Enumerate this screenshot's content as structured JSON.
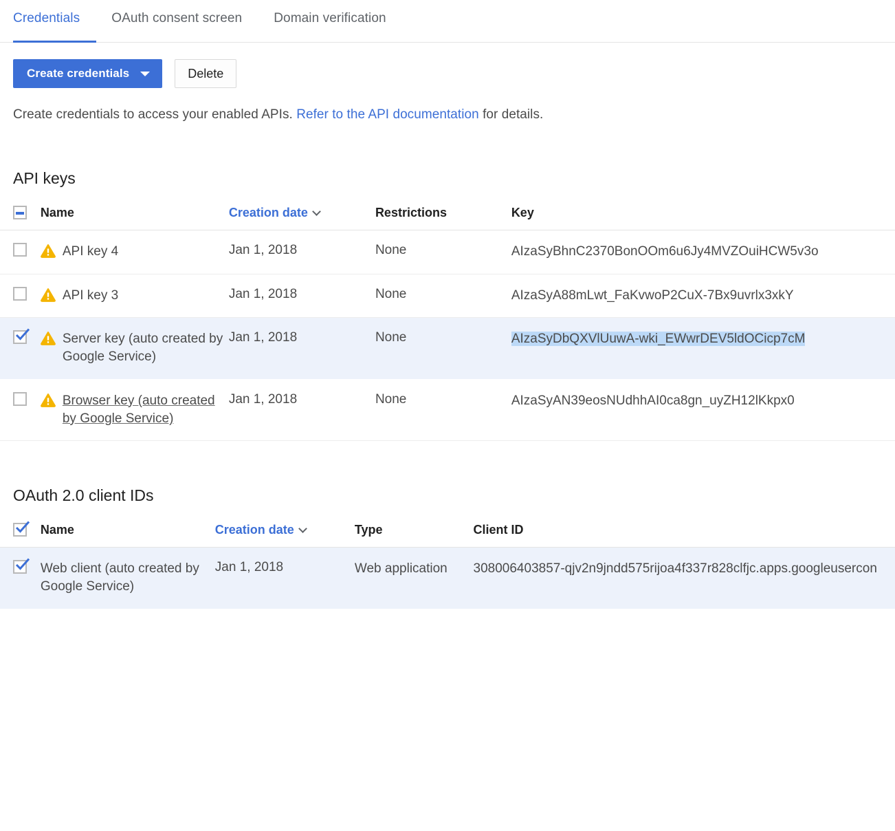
{
  "tabs": [
    {
      "label": "Credentials",
      "active": true
    },
    {
      "label": "OAuth consent screen",
      "active": false
    },
    {
      "label": "Domain verification",
      "active": false
    }
  ],
  "toolbar": {
    "create_label": "Create credentials",
    "delete_label": "Delete"
  },
  "description": {
    "before": "Create credentials to access your enabled APIs. ",
    "link": "Refer to the API documentation",
    "after": " for details."
  },
  "api_keys": {
    "title": "API keys",
    "header_checkbox_state": "indeterminate",
    "columns": [
      "Name",
      "Creation date",
      "Restrictions",
      "Key"
    ],
    "sorted_column": "Creation date",
    "rows": [
      {
        "checked": false,
        "warning": true,
        "name": "API key 4",
        "name_linked": false,
        "creation_date": "Jan 1, 2018",
        "restrictions": "None",
        "key": "AIzaSyBhnC2370BonOOm6u6Jy4MVZOuiHCW5v3o",
        "key_highlighted": false,
        "selected": false
      },
      {
        "checked": false,
        "warning": true,
        "name": "API key 3",
        "name_linked": false,
        "creation_date": "Jan 1, 2018",
        "restrictions": "None",
        "key": "AIzaSyA88mLwt_FaKvwoP2CuX-7Bx9uvrlx3xkY",
        "key_highlighted": false,
        "selected": false
      },
      {
        "checked": true,
        "warning": true,
        "name": "Server key (auto created by Google Service)",
        "name_linked": false,
        "creation_date": "Jan 1, 2018",
        "restrictions": "None",
        "key": "AIzaSyDbQXVlUuwA-wki_EWwrDEV5ldOCicp7cM",
        "key_highlighted": true,
        "selected": true
      },
      {
        "checked": false,
        "warning": true,
        "name": "Browser key (auto created by Google Service)",
        "name_linked": true,
        "creation_date": "Jan 1, 2018",
        "restrictions": "None",
        "key": "AIzaSyAN39eosNUdhhAI0ca8gn_uyZH12lKkpx0",
        "key_highlighted": false,
        "selected": false
      }
    ]
  },
  "oauth_clients": {
    "title": "OAuth 2.0 client IDs",
    "header_checkbox_state": "checked",
    "columns": [
      "Name",
      "Creation date",
      "Type",
      "Client ID"
    ],
    "sorted_column": "Creation date",
    "rows": [
      {
        "checked": true,
        "name": "Web client (auto created by Google Service)",
        "creation_date": "Jan 1, 2018",
        "type": "Web application",
        "client_id": "308006403857-qjv2n9jndd575rijoa4f337r828clfjc.apps.googleusercon",
        "selected": true
      }
    ]
  },
  "colors": {
    "accent_blue": "#3c6fd6",
    "warning_amber": "#f4b400",
    "selected_row_bg": "#edf2fb",
    "text_highlight": "#bcd9f7"
  }
}
